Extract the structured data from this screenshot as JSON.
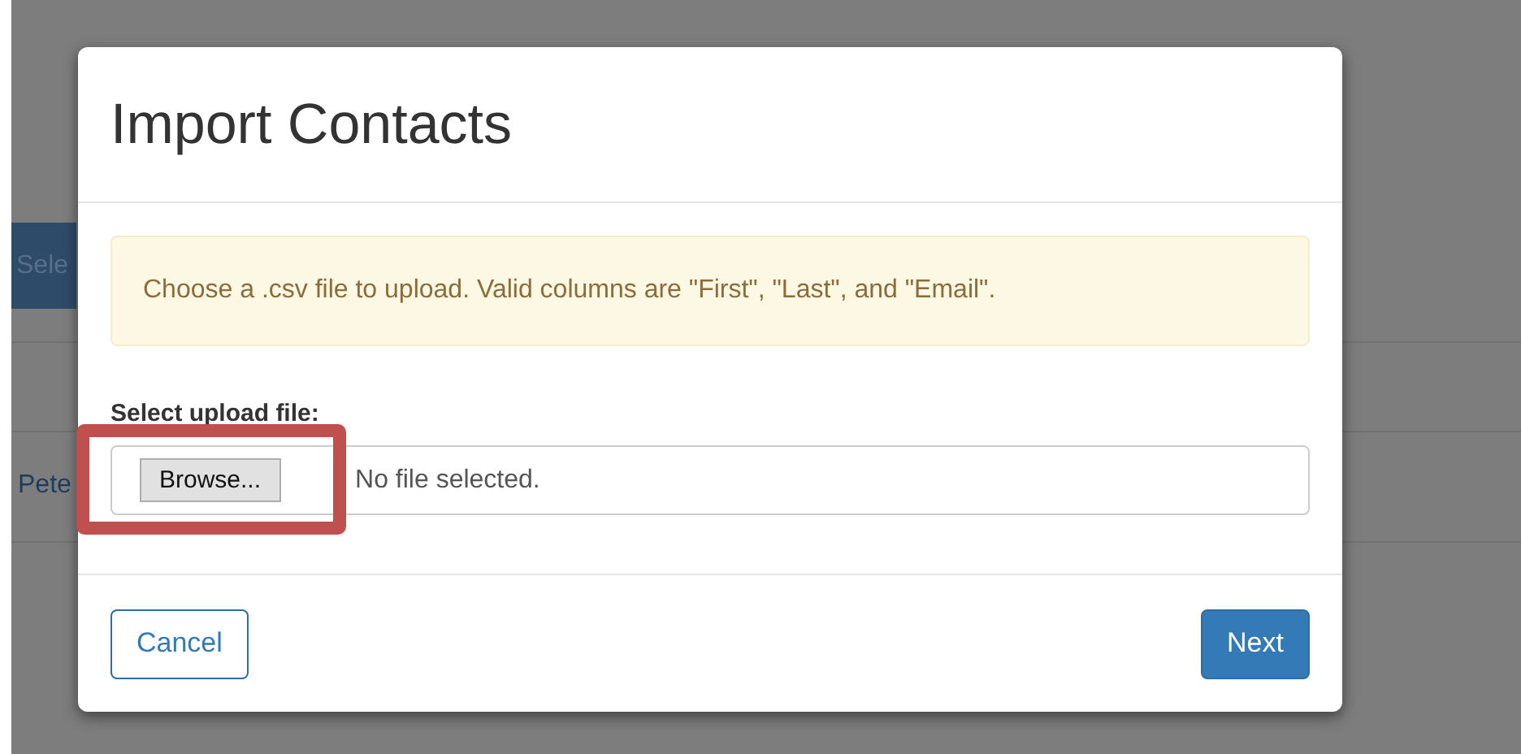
{
  "background": {
    "button": "Sele",
    "link": "Pete"
  },
  "modal": {
    "title": "Import Contacts",
    "alert": "Choose a .csv file to upload. Valid columns are \"First\", \"Last\", and \"Email\".",
    "field_label": "Select upload file:",
    "file_input": {
      "button": "Browse...",
      "status": "No file selected."
    },
    "buttons": [
      {
        "kind": "secondary",
        "label": "Cancel"
      },
      {
        "kind": "primary",
        "label": "Next"
      }
    ]
  },
  "annotations": [
    {
      "kind": "box"
    }
  ]
}
